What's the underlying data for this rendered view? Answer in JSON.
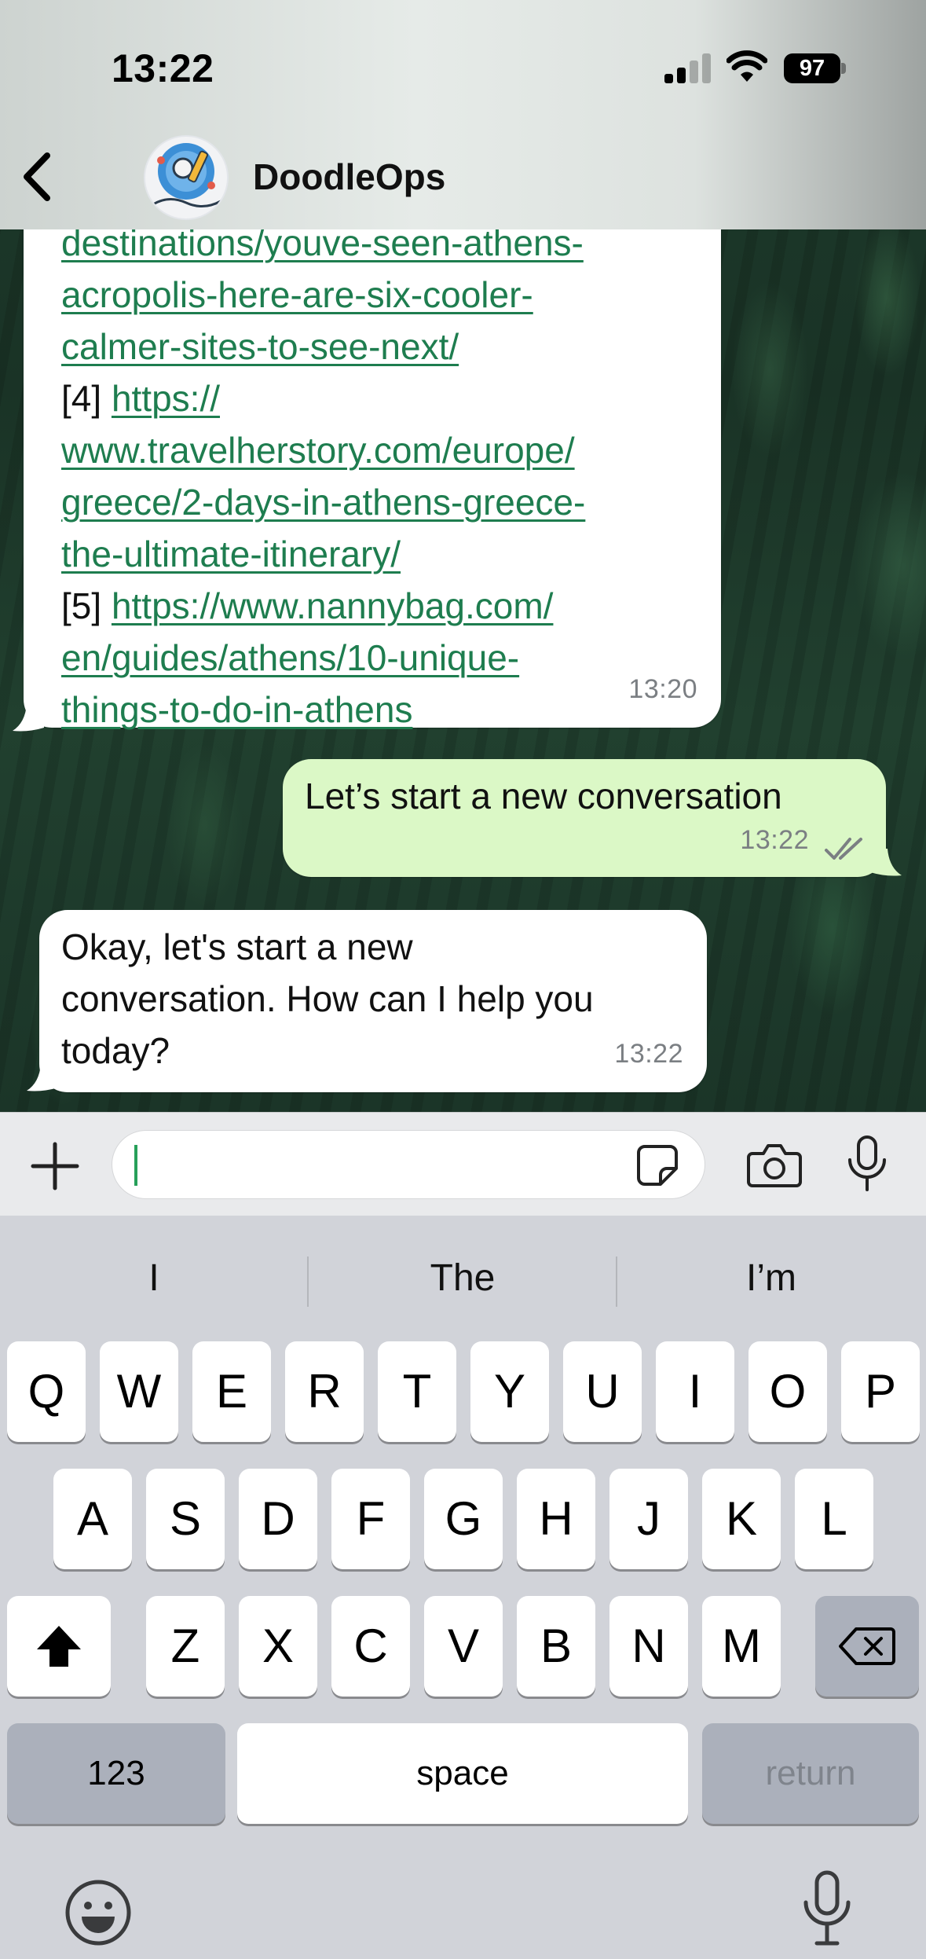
{
  "status_bar": {
    "time": "13:22",
    "battery": "97",
    "icons": [
      "signal-icon",
      "wifi-icon",
      "battery-icon"
    ]
  },
  "header": {
    "contact_name": "DoodleOps",
    "avatar_text": "DoodleOps",
    "icons": [
      "back-icon",
      "avatar"
    ]
  },
  "messages": [
    {
      "direction": "incoming",
      "lines": [
        {
          "prefix": "",
          "link": "destinations/youve-seen-athens-"
        },
        {
          "prefix": "",
          "link": "acropolis-here-are-six-cooler-"
        },
        {
          "prefix": "",
          "link": "calmer-sites-to-see-next/"
        },
        {
          "prefix": "[4] ",
          "link": "https://"
        },
        {
          "prefix": "",
          "link": "www.travelherstory.com/europe/"
        },
        {
          "prefix": "",
          "link": "greece/2-days-in-athens-greece-"
        },
        {
          "prefix": "",
          "link": "the-ultimate-itinerary/"
        },
        {
          "prefix": "[5] ",
          "link": "https://www.nannybag.com/"
        },
        {
          "prefix": "",
          "link": "en/guides/athens/10-unique-"
        },
        {
          "prefix": "",
          "link": "things-to-do-in-athens"
        }
      ],
      "time": "13:20"
    },
    {
      "direction": "outgoing",
      "text": "Let’s start a new conversation",
      "time": "13:22",
      "read_receipt": "double-check-icon"
    },
    {
      "direction": "incoming",
      "lines": [
        "Okay, let's start a new",
        "conversation. How can I help you",
        "today?"
      ],
      "time": "13:22"
    }
  ],
  "input_bar": {
    "value": "",
    "placeholder": "",
    "icons": [
      "plus-icon",
      "sticker-icon",
      "camera-icon",
      "mic-icon"
    ]
  },
  "keyboard": {
    "suggestions": [
      "I",
      "The",
      "I’m"
    ],
    "rows": [
      [
        "Q",
        "W",
        "E",
        "R",
        "T",
        "Y",
        "U",
        "I",
        "O",
        "P"
      ],
      [
        "A",
        "S",
        "D",
        "F",
        "G",
        "H",
        "J",
        "K",
        "L"
      ],
      [
        "Z",
        "X",
        "C",
        "V",
        "B",
        "N",
        "M"
      ]
    ],
    "numbers_label": "123",
    "space_label": "space",
    "return_label": "return",
    "icons": [
      "shift-icon",
      "backspace-icon",
      "emoji-icon",
      "dictation-icon"
    ]
  },
  "colors": {
    "link": "#1e7d4f",
    "outgoing_bubble": "#dbf8c6",
    "incoming_bubble": "#ffffff",
    "caret": "#27a05a"
  }
}
